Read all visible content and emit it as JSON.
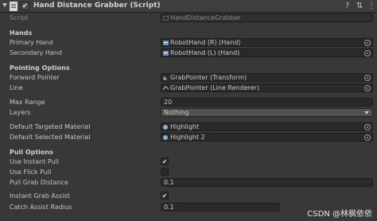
{
  "header": {
    "title": "Hand Distance Grabber (Script)",
    "enabled": "✔",
    "help_icon": "?",
    "preset_icon": "⇅",
    "menu_icon": "⋮"
  },
  "script": {
    "label": "Script",
    "value": "HandDistanceGrabber"
  },
  "hands": {
    "section": "Hands",
    "primary_label": "Primary Hand",
    "primary_value": "RobotHand (R) (Hand)",
    "secondary_label": "Secondary Hand",
    "secondary_value": "RobotHand (L) (Hand)"
  },
  "pointing": {
    "section": "Pointing Options",
    "forward_label": "Forward Pointer",
    "forward_value": "GrabPointer (Transform)",
    "line_label": "Line",
    "line_value": "GrabPointer (Line Renderer)"
  },
  "max_range": {
    "label": "Max Range",
    "value": "20"
  },
  "layers": {
    "label": "Layers",
    "value": "Nothing"
  },
  "materials": {
    "targeted_label": "Default Targeted Material",
    "targeted_value": "Highlight",
    "selected_label": "Default Selected Material",
    "selected_value": "Highlight 2"
  },
  "pull": {
    "section": "Pull Options",
    "instant_label": "Use Instant Pull",
    "instant_check": "✔",
    "flick_label": "Use Flick Pull",
    "flick_check": "",
    "distance_label": "Pull Grab Distance",
    "distance_value": "0.1",
    "assist_label": "Instant Grab Assist",
    "assist_check": "✔",
    "catch_label": "Catch Assist Radius",
    "catch_value": "0.1"
  },
  "watermark": "CSDN @林枫依依"
}
